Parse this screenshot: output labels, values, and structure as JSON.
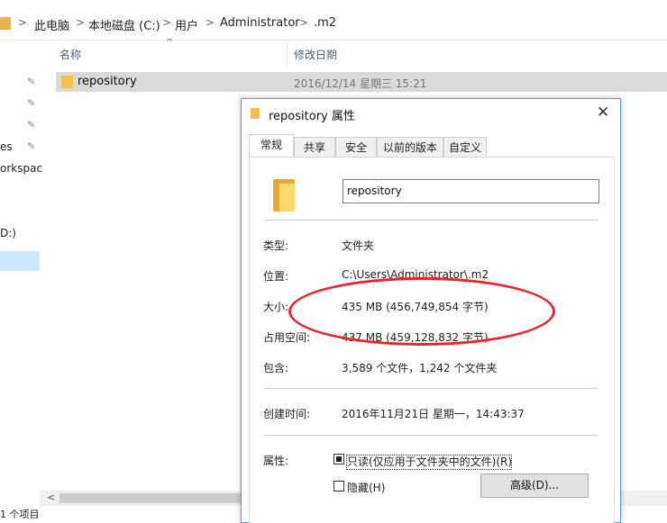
{
  "address_bar": {
    "crumbs": [
      "此电脑",
      "本地磁盘 (C:)",
      "用户",
      "Administrator",
      ".m2"
    ],
    "separator": ">"
  },
  "left_nav": {
    "items": [
      "es",
      "orkspac",
      "D:)"
    ]
  },
  "columns": {
    "name": "名称",
    "modified": "修改日期"
  },
  "files": [
    {
      "name": "repository",
      "modified": "2016/12/14 星期三 15:21"
    }
  ],
  "status_bar": {
    "text": "1 个项目"
  },
  "dialog": {
    "title": "repository 属性",
    "close": "✕",
    "tabs": [
      "常规",
      "共享",
      "安全",
      "以前的版本",
      "自定义"
    ],
    "active_tab": "常规",
    "name_value": "repository",
    "fields": {
      "type_label": "类型:",
      "type_value": "文件夹",
      "location_label": "位置:",
      "location_value": "C:\\Users\\Administrator\\.m2",
      "size_label": "大小:",
      "size_value": "435 MB (456,749,854 字节)",
      "disk_size_label": "占用空间:",
      "disk_size_value": "437 MB (459,128,832 字节)",
      "contains_label": "包含:",
      "contains_value": "3,589 个文件，1,242 个文件夹",
      "created_label": "创建时间:",
      "created_value": "2016年11月21日 星期一，14:43:37",
      "attributes_label": "属性:"
    },
    "readonly_label": "只读(仅应用于文件夹中的文件)(R)",
    "hidden_label": "隐藏(H)",
    "advanced_button": "高级(D)..."
  },
  "colors": {
    "annotation": "#e8262b",
    "folder": "#f0c24b",
    "selection": "#d9d9d9",
    "dialog_border": "#5b9bd5"
  }
}
